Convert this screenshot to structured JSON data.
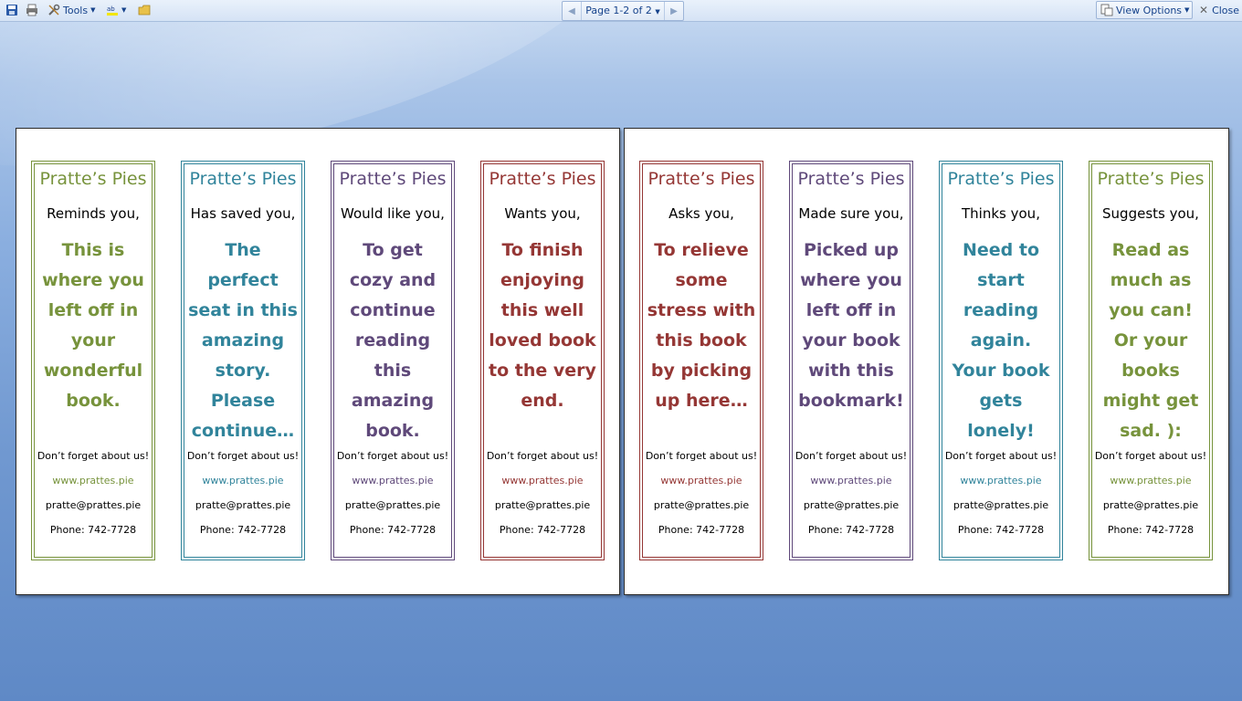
{
  "toolbar": {
    "tools_label": "Tools",
    "page_indicator": "Page 1-2 of 2",
    "view_options_label": "View Options",
    "close_label": "Close"
  },
  "colors": {
    "green": "#77933c",
    "teal": "#31849b",
    "purple": "#5f497a",
    "red": "#953735"
  },
  "footer": {
    "reminder": "Don’t forget about us!",
    "website": "www.prattes.pie",
    "email": "pratte@prattes.pie",
    "phone": "Phone: 742-7728"
  },
  "bookmarks": [
    {
      "title": "Pratte’s Pies",
      "intro": "Reminds you,",
      "message": "This is where you left off in your wonderful book.",
      "color": "#77933c"
    },
    {
      "title": "Pratte’s Pies",
      "intro": "Has saved you,",
      "message": "The perfect seat in this amazing story. Please continue…",
      "color": "#31849b"
    },
    {
      "title": "Pratte’s Pies",
      "intro": "Would like you,",
      "message": "To get cozy and continue reading this amazing book.",
      "color": "#5f497a"
    },
    {
      "title": "Pratte’s Pies",
      "intro": "Wants  you,",
      "message": "To finish enjoying this well loved book to the very end.",
      "color": "#953735"
    },
    {
      "title": "Pratte’s Pies",
      "intro": "Asks you,",
      "message": "To relieve some stress with this book by picking up here…",
      "color": "#953735"
    },
    {
      "title": "Pratte’s Pies",
      "intro": "Made sure  you,",
      "message": "Picked up where you left off in your book with this bookmark!",
      "color": "#5f497a"
    },
    {
      "title": "Pratte’s Pies",
      "intro": "Thinks you,",
      "message": "Need to start reading again. Your book gets lonely!",
      "color": "#31849b"
    },
    {
      "title": "Pratte’s Pies",
      "intro": "Suggests  you,",
      "message": "Read as much as you can! Or your books might get sad. ):",
      "color": "#77933c"
    }
  ]
}
